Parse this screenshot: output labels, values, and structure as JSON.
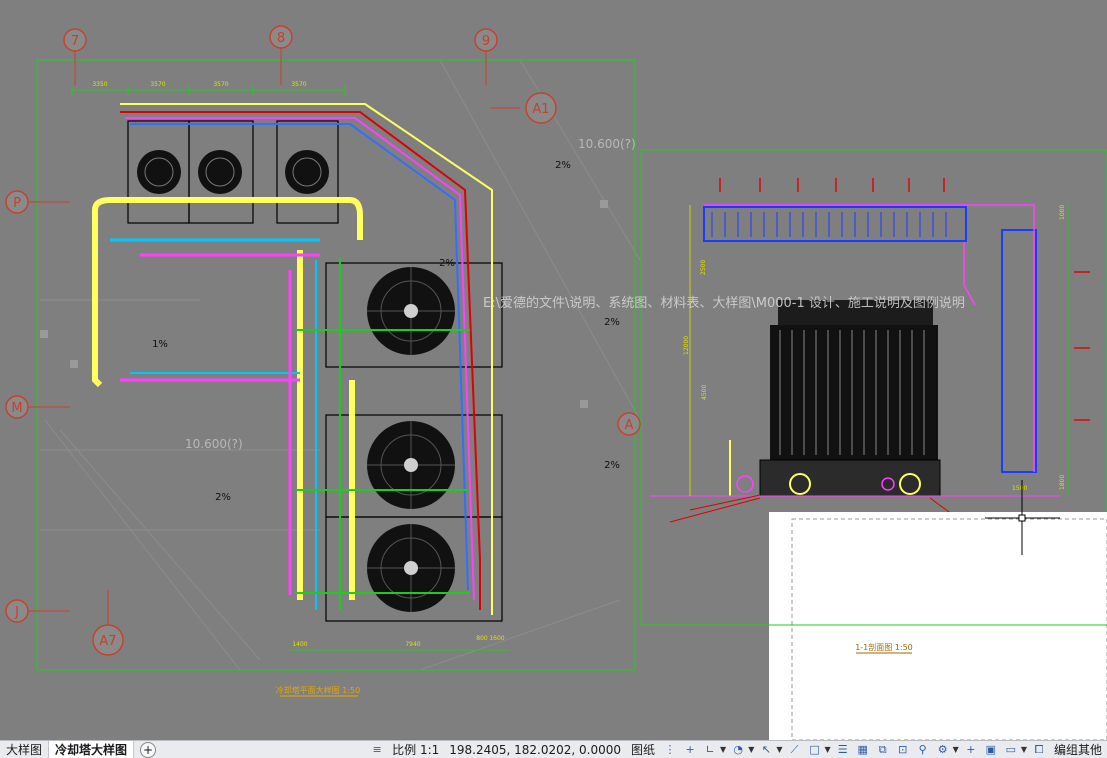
{
  "drawing": {
    "grid_bubbles": {
      "g7": "7",
      "g8": "8",
      "g9": "9",
      "A1": "A1",
      "P": "P",
      "M": "M",
      "J": "J",
      "A7": "A7",
      "A": "A"
    },
    "dims_top": [
      "3350",
      "3570",
      "3570",
      "3570"
    ],
    "dims_bottom": [
      "1400",
      "7940",
      "800",
      "1600"
    ],
    "dims_right": [
      "1000",
      "2500",
      "12000",
      "4500",
      "1800"
    ],
    "dims_section_bottom": [
      "1500"
    ],
    "slopes": [
      "2%",
      "2%",
      "2%",
      "2%",
      "2%",
      "1%"
    ],
    "elevations": [
      "10.600(?)",
      "10.600(?)"
    ],
    "plan_title": "冷却塔平面大样图 1:50",
    "section_title": "1-1剖面图 1:50"
  },
  "overlay": {
    "path_text": "E:\\爱德的文件\\说明、系统图、材料表、大样图\\M000-1 设计、施工说明及图例说明"
  },
  "statusbar": {
    "tab_prev": "大样图",
    "tab_active": "冷却塔大样图",
    "tab_add": "+",
    "scale_label": "比例 1:1",
    "coords": "198.2405, 182.0202, 0.0000",
    "paper_label": "图纸",
    "right_label": "编组其他"
  }
}
